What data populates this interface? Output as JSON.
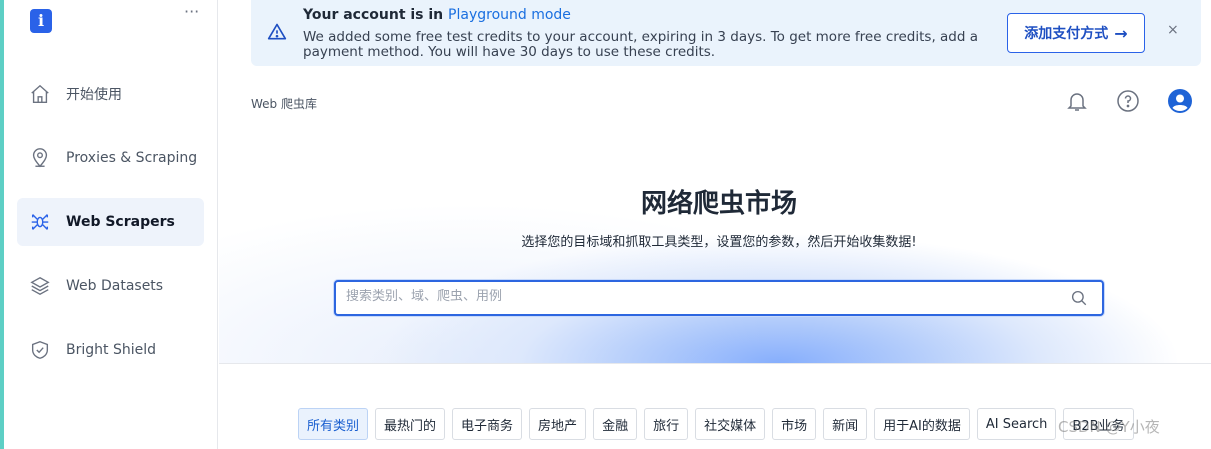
{
  "sidebar": {
    "logo_letter": "i",
    "more_label": "···",
    "items": [
      {
        "label": "开始使用",
        "icon": "home-icon"
      },
      {
        "label": "Proxies & Scraping",
        "icon": "location-pin-icon"
      },
      {
        "label": "Web Scrapers",
        "icon": "spider-icon",
        "active": true
      },
      {
        "label": "Web Datasets",
        "icon": "layers-icon"
      },
      {
        "label": "Bright Shield",
        "icon": "shield-check-icon"
      }
    ]
  },
  "banner": {
    "title_prefix": "Your account is in ",
    "title_mode": "Playground mode",
    "text": "We added some free test credits to your account, expiring in 3 days. To get more free credits, add a payment method. You will have 30 days to use these credits.",
    "button_label": "添加支付方式",
    "button_arrow": "→",
    "close_label": "×"
  },
  "header": {
    "breadcrumb": "Web 爬虫库"
  },
  "hero": {
    "title": "网络爬虫市场",
    "subtitle": "选择您的目标域和抓取工具类型，设置您的参数，然后开始收集数据!",
    "search_placeholder": "搜索类别、域、爬虫、用例"
  },
  "categories": [
    {
      "label": "所有类别",
      "active": true
    },
    {
      "label": "最热门的"
    },
    {
      "label": "电子商务"
    },
    {
      "label": "房地产"
    },
    {
      "label": "金融"
    },
    {
      "label": "旅行"
    },
    {
      "label": "社交媒体"
    },
    {
      "label": "市场"
    },
    {
      "label": "新闻"
    },
    {
      "label": "用于AI的数据"
    },
    {
      "label": "AI Search"
    },
    {
      "label": "B2B业务"
    }
  ],
  "watermark": "CSDN @Y小夜",
  "colors": {
    "accent": "#2a62e8",
    "banner_bg": "#eaf3fc",
    "left_accent": "#5dcfc5"
  }
}
